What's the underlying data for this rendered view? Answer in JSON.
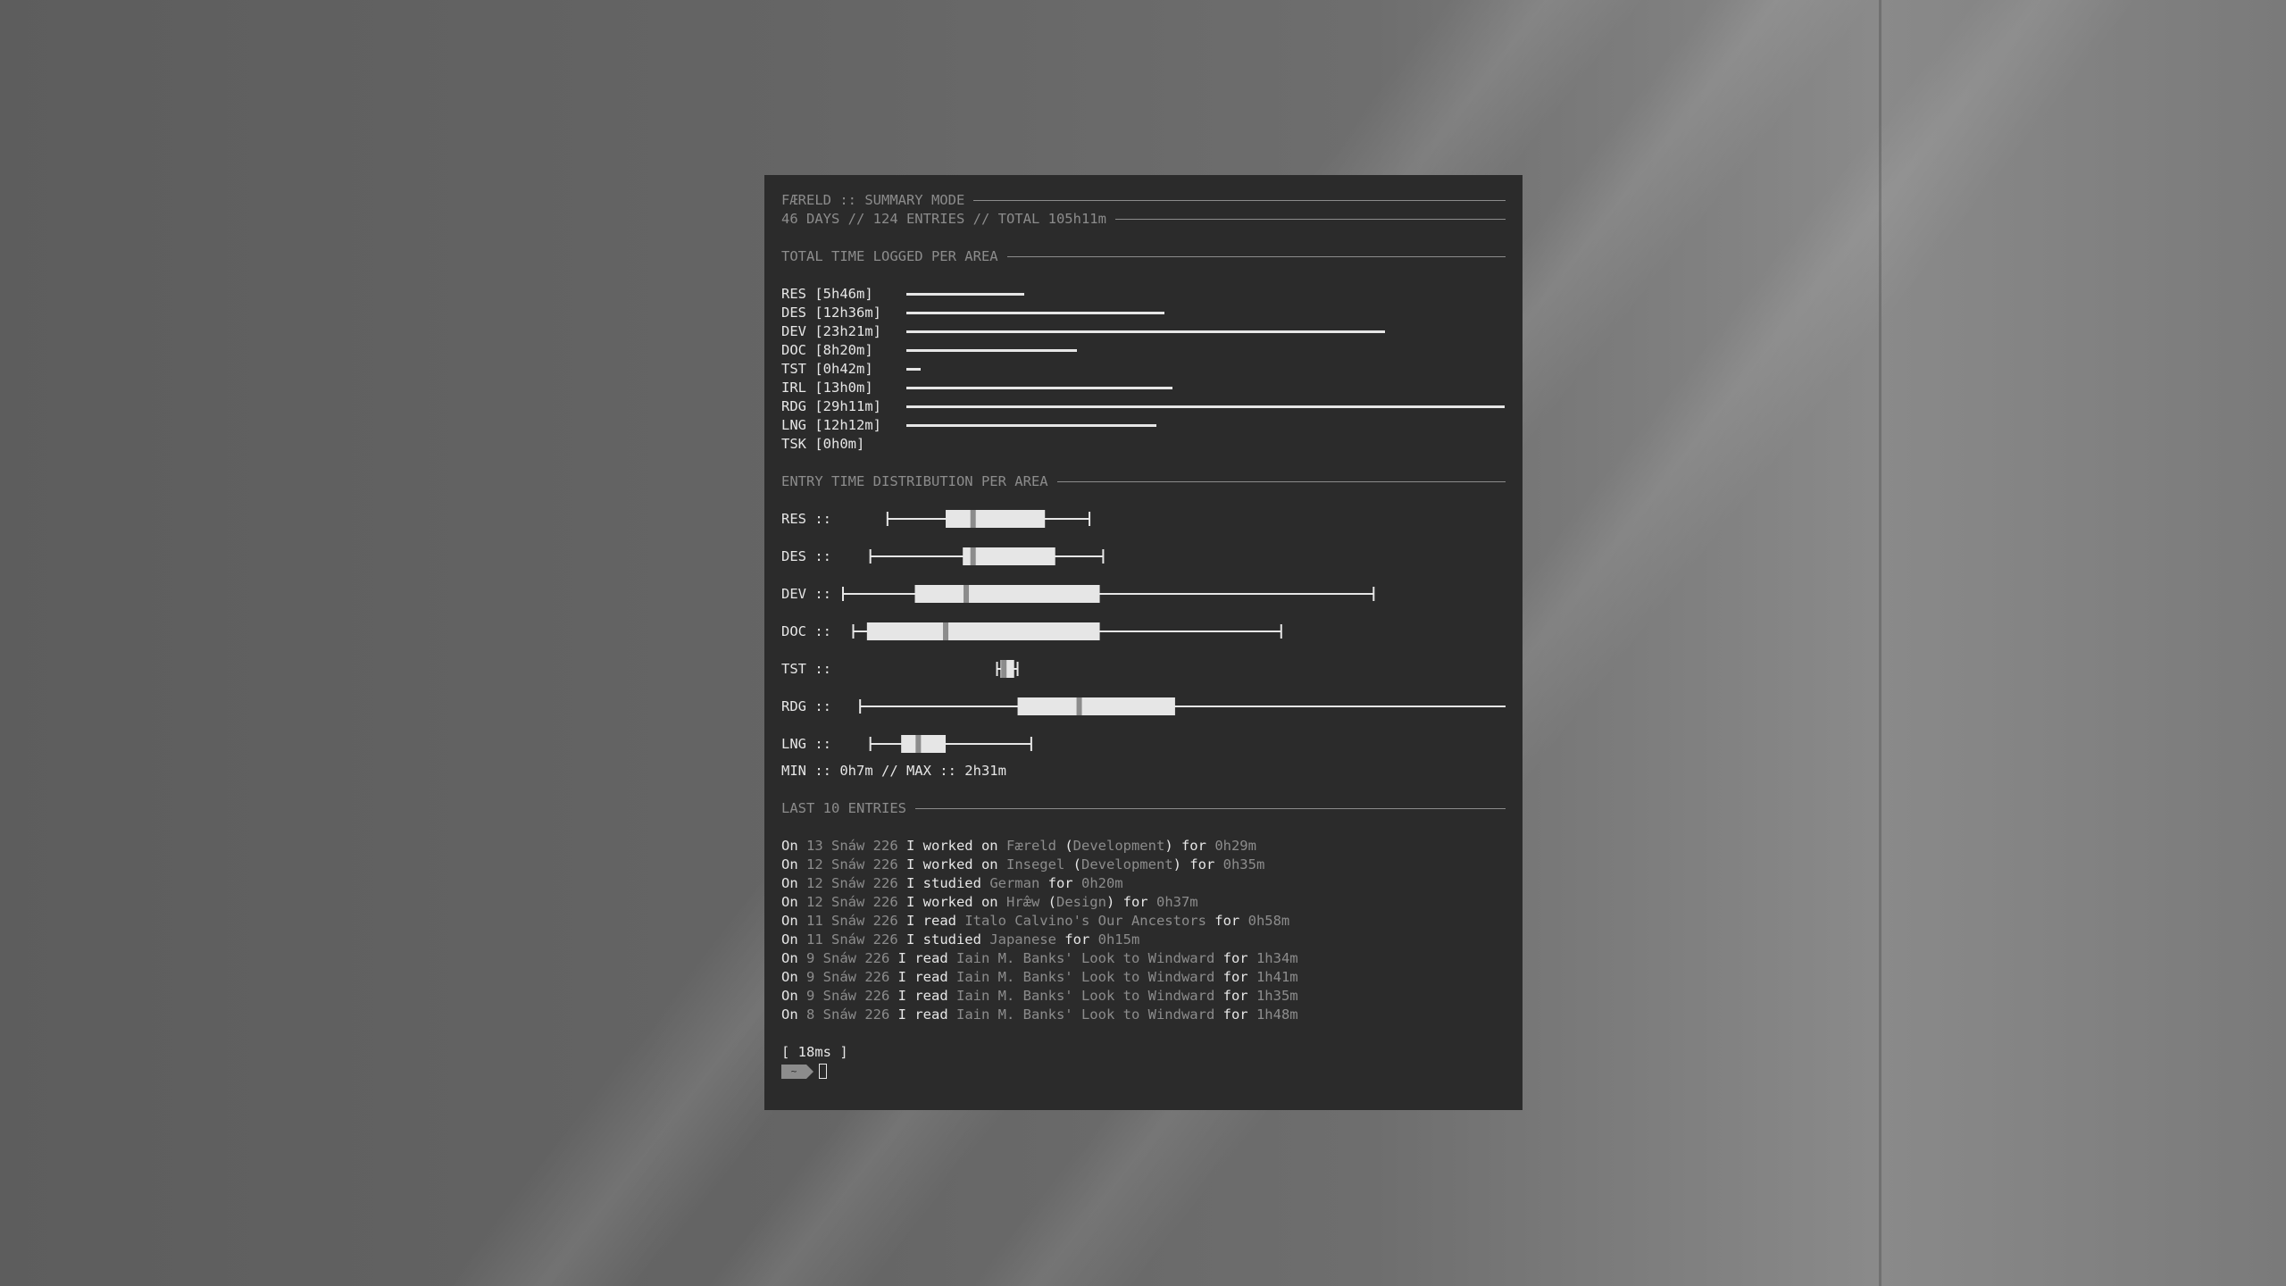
{
  "header": {
    "title": "FÆRELD :: SUMMARY MODE",
    "stats": "46 DAYS // 124 ENTRIES // TOTAL 105h11m"
  },
  "totals": {
    "heading": "TOTAL TIME LOGGED PER AREA",
    "max_minutes": 1751,
    "items": [
      {
        "label": "RES [5h46m]",
        "minutes": 346
      },
      {
        "label": "DES [12h36m]",
        "minutes": 756
      },
      {
        "label": "DEV [23h21m]",
        "minutes": 1401
      },
      {
        "label": "DOC [8h20m]",
        "minutes": 500
      },
      {
        "label": "TST [0h42m]",
        "minutes": 42
      },
      {
        "label": "IRL [13h0m]",
        "minutes": 780
      },
      {
        "label": "RDG [29h11m]",
        "minutes": 1751
      },
      {
        "label": "LNG [12h12m]",
        "minutes": 732
      },
      {
        "label": "TSK [0h0m]",
        "minutes": 0
      }
    ]
  },
  "distribution": {
    "heading": "ENTRY TIME DISTRIBUTION PER AREA",
    "axis_min_minutes": 0,
    "axis_max_minutes": 151,
    "items": [
      {
        "label": "RES ::",
        "min": 13,
        "q1": 30,
        "median": 38,
        "q3": 59,
        "max": 72
      },
      {
        "label": "DES ::",
        "min": 8,
        "q1": 35,
        "median": 38,
        "q3": 62,
        "max": 76
      },
      {
        "label": "DEV ::",
        "min": 0,
        "q1": 21,
        "median": 36,
        "q3": 75,
        "max": 155
      },
      {
        "label": "DOC ::",
        "min": 3,
        "q1": 7,
        "median": 30,
        "q3": 75,
        "max": 128
      },
      {
        "label": "TST ::",
        "min": 45,
        "q1": 46,
        "median": 47,
        "q3": 50,
        "max": 51
      },
      {
        "label": "RDG ::",
        "min": 5,
        "q1": 51,
        "median": 69,
        "q3": 97,
        "max": 194
      },
      {
        "label": "LNG ::",
        "min": 8,
        "q1": 17,
        "median": 22,
        "q3": 30,
        "max": 55
      }
    ],
    "range_text": "MIN :: 0h7m // MAX :: 2h31m"
  },
  "entries": {
    "heading": "LAST 10 ENTRIES",
    "items": [
      {
        "on": "On ",
        "date": "13 Snáw 226",
        "verb": " I worked on ",
        "subject": "Færeld",
        "pre": " (",
        "area": "Development",
        "post": ") for ",
        "dur": "0h29m"
      },
      {
        "on": "On ",
        "date": "12 Snáw 226",
        "verb": " I worked on ",
        "subject": "Insegel",
        "pre": " (",
        "area": "Development",
        "post": ") for ",
        "dur": "0h35m"
      },
      {
        "on": "On ",
        "date": "12 Snáw 226",
        "verb": " I studied ",
        "subject": "German",
        "pre": "",
        "area": "",
        "post": " for ",
        "dur": "0h20m"
      },
      {
        "on": "On ",
        "date": "12 Snáw 226",
        "verb": " I worked on ",
        "subject": "Hræ̂w",
        "pre": " (",
        "area": "Design",
        "post": ") for ",
        "dur": "0h37m"
      },
      {
        "on": "On ",
        "date": "11 Snáw 226",
        "verb": " I read ",
        "subject": "Italo Calvino's Our Ancestors",
        "pre": "",
        "area": "",
        "post": " for ",
        "dur": "0h58m"
      },
      {
        "on": "On ",
        "date": "11 Snáw 226",
        "verb": " I studied ",
        "subject": "Japanese",
        "pre": "",
        "area": "",
        "post": " for ",
        "dur": "0h15m"
      },
      {
        "on": "On ",
        "date": "9 Snáw 226",
        "verb": " I read ",
        "subject": "Iain M. Banks' Look to Windward",
        "pre": "",
        "area": "",
        "post": " for ",
        "dur": "1h34m"
      },
      {
        "on": "On ",
        "date": "9 Snáw 226",
        "verb": " I read ",
        "subject": "Iain M. Banks' Look to Windward",
        "pre": "",
        "area": "",
        "post": " for ",
        "dur": "1h41m"
      },
      {
        "on": "On ",
        "date": "9 Snáw 226",
        "verb": " I read ",
        "subject": "Iain M. Banks' Look to Windward",
        "pre": "",
        "area": "",
        "post": " for ",
        "dur": "1h35m"
      },
      {
        "on": "On ",
        "date": "8 Snáw 226",
        "verb": " I read ",
        "subject": "Iain M. Banks' Look to Windward",
        "pre": "",
        "area": "",
        "post": " for ",
        "dur": "1h48m"
      }
    ]
  },
  "footer": {
    "timing": "[ 18ms ]",
    "prompt_symbol": "~"
  },
  "colors": {
    "terminal_bg": "#2b2b2b",
    "text": "#e6e6e6",
    "dim": "#8c8c8c"
  }
}
